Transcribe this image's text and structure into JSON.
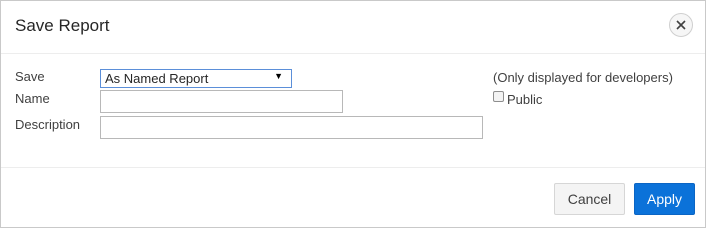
{
  "dialog": {
    "title": "Save Report",
    "close_icon": "close-icon"
  },
  "form": {
    "save_label": "Save",
    "save_value": "As Named Report",
    "name_label": "Name",
    "name_value": "",
    "description_label": "Description",
    "description_value": "",
    "developer_note": "(Only displayed for developers)",
    "public_label": "Public",
    "public_checked": false
  },
  "footer": {
    "cancel_label": "Cancel",
    "apply_label": "Apply"
  },
  "colors": {
    "apply_bg": "#0b72d9",
    "select_border": "#5b8fd9"
  }
}
